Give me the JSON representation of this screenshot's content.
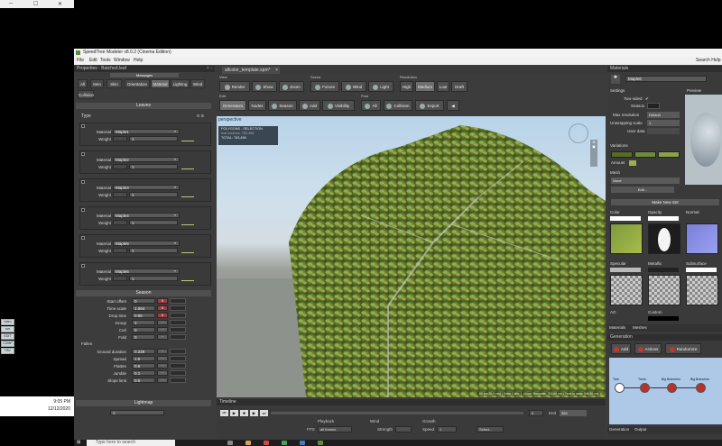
{
  "app": {
    "title": "SpeedTree Modeler v8.0.2 (Cinema Edition)",
    "menu": [
      "File",
      "Edit",
      "Tools",
      "Window",
      "Help"
    ],
    "search_help": "Search Help"
  },
  "properties": {
    "header": "Properties - Batched.leaf",
    "messages": "Messages",
    "tabs": [
      "All",
      "Item",
      "Skin",
      "Orientation",
      "Material",
      "Lighting",
      "Wind",
      "Collision"
    ],
    "active_tab": "Material",
    "leaves_title": "Leaves",
    "type_title": "Type",
    "material_label": "Material",
    "weight_label": "Weight",
    "materials": [
      {
        "material": "Maple1",
        "weight": "1"
      },
      {
        "material": "Maple2",
        "weight": "1"
      },
      {
        "material": "Maple3",
        "weight": "1"
      },
      {
        "material": "Maple4",
        "weight": "1"
      },
      {
        "material": "Maple5",
        "weight": "1"
      },
      {
        "material": "Maple6",
        "weight": "1"
      }
    ],
    "season_title": "Season",
    "season_rows": [
      {
        "label": "Start offset",
        "value": "0"
      },
      {
        "label": "Time scale",
        "value": "1.064"
      },
      {
        "label": "Drop time",
        "value": "0.96"
      },
      {
        "label": "Group",
        "value": "1"
      },
      {
        "label": "Curl",
        "value": "0"
      },
      {
        "label": "Fold",
        "value": "0"
      }
    ],
    "fallen_title": "Fallen",
    "fallen_rows": [
      {
        "label": "Ground duration",
        "value": "0.228"
      },
      {
        "label": "Spread",
        "value": "1.5"
      },
      {
        "label": "Flatten",
        "value": "0.5"
      },
      {
        "label": "Jumble",
        "value": "0.1"
      },
      {
        "label": "Slope limit",
        "value": "0.5"
      }
    ],
    "lightmap_title": "Lightmap",
    "lightmap_weight": "1"
  },
  "viewer": {
    "file_tab": "allcolor_template.spm*",
    "groups": {
      "view": "View",
      "scene": "Scene",
      "resolution": "Resolution",
      "edit": "Edit",
      "post": "Post"
    },
    "view_buttons": [
      "Render",
      "Show",
      "Zoom"
    ],
    "scene_buttons": [
      "Forces",
      "Wind",
      "Light"
    ],
    "resolution_buttons": [
      "High",
      "Medium",
      "Low",
      "Draft"
    ],
    "active_resolution": "Medium",
    "edit_buttons": [
      "Generators",
      "Nodes",
      "Season",
      "Add",
      "Visibility"
    ],
    "post_buttons": [
      "All",
      "Collision",
      "Export"
    ],
    "perspective_label": "perspective",
    "stats": {
      "line1": "POLYGONS - SELECTION",
      "line2": "leaf meshes: 783,456",
      "line3": "TOTAL: 783,456"
    },
    "status": "50 fps(20.0 ms) | Draw Calls: 1 | Load Template: 781.66 ms | Time to draw 394.89 ms"
  },
  "timeline": {
    "title": "Timeline",
    "playback_label": "Playback",
    "fps_label": "FPS",
    "fps_value": "all frames",
    "wind_label": "Wind",
    "strength_label": "Strength",
    "growth_label": "Growth",
    "speed_label": "Speed",
    "speed_value": "1",
    "select_label": "Select...",
    "frame_value": "0",
    "end_label": "End",
    "end_value": "360"
  },
  "materials_panel": {
    "header": "Materials",
    "material_name": "Maple6",
    "settings_title": "Settings",
    "preview_title": "Preview",
    "two_sided": "Two-sided",
    "season": "Season",
    "max_resolution": "Max resolution",
    "max_resolution_value": "Default",
    "unwrapping_scale": "Unwrapping scale",
    "unwrapping_value": "1",
    "user_data": "User data",
    "variations": "Variations",
    "amount": "Amount",
    "mesh_title": "Mesh",
    "mesh_value": "None",
    "edit_btn": "Edit...",
    "make_new_set": "Make New Set",
    "maps": [
      "Color",
      "Opacity",
      "Normal",
      "Specular",
      "Metallic",
      "Subsurface"
    ],
    "ao_label": "AO",
    "custom_label": "Custom",
    "bottom_tabs": [
      "Materials",
      "Meshes"
    ],
    "generation": {
      "title": "Generation",
      "add": "Add",
      "actions": "Actions",
      "randomize": "Randomize",
      "nodes": [
        "Tree",
        "Trunk",
        "Big Branches",
        "Big Branches"
      ],
      "bottom_tabs": [
        "Generation",
        "Output"
      ]
    },
    "colors": {
      "var1": "#7d8f3a",
      "var2": "#6f8a3c",
      "var3": "#8aa04a",
      "opacity_tile": "#222"
    }
  },
  "desktop": {
    "time": "9:05 PM",
    "date": "12/12/2020",
    "search_placeholder": "Type here to search",
    "tray": [
      "video",
      "cvs",
      "EDIT",
      "COMP",
      "FAV"
    ]
  },
  "accent": "#a53a3a"
}
